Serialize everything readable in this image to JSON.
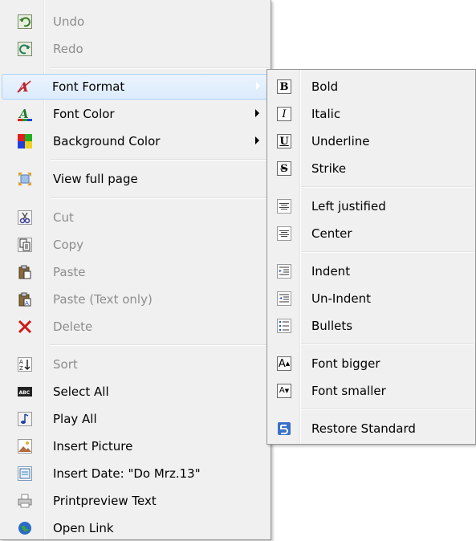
{
  "main_menu": {
    "items": [
      {
        "label": "Undo",
        "icon": "undo-icon",
        "disabled": true
      },
      {
        "label": "Redo",
        "icon": "redo-icon",
        "disabled": true
      },
      {
        "label": "Font Format",
        "icon": "font-format-icon",
        "disabled": false,
        "submenu": true,
        "highlighted": true
      },
      {
        "label": "Font Color",
        "icon": "font-color-icon",
        "disabled": false,
        "submenu": true
      },
      {
        "label": "Background Color",
        "icon": "background-color-icon",
        "disabled": false,
        "submenu": true
      },
      {
        "label": "View full page",
        "icon": "view-full-page-icon",
        "disabled": false
      },
      {
        "label": "Cut",
        "icon": "scissors-icon",
        "disabled": true
      },
      {
        "label": "Copy",
        "icon": "copy-icon",
        "disabled": true
      },
      {
        "label": "Paste",
        "icon": "paste-icon",
        "disabled": true
      },
      {
        "label": "Paste (Text only)",
        "icon": "paste-text-icon",
        "disabled": true
      },
      {
        "label": "Delete",
        "icon": "delete-icon",
        "disabled": true
      },
      {
        "label": "Sort",
        "icon": "sort-icon",
        "disabled": true
      },
      {
        "label": "Select All",
        "icon": "select-all-icon",
        "disabled": false
      },
      {
        "label": "Play All",
        "icon": "play-all-icon",
        "disabled": false
      },
      {
        "label": "Insert Picture",
        "icon": "insert-picture-icon",
        "disabled": false
      },
      {
        "label": "Insert Date: \"Do Mrz.13\"",
        "icon": "insert-date-icon",
        "disabled": false
      },
      {
        "label": "Printpreview Text",
        "icon": "print-preview-icon",
        "disabled": false
      },
      {
        "label": "Open Link",
        "icon": "globe-icon",
        "disabled": false
      }
    ]
  },
  "sub_menu": {
    "items": [
      {
        "label": "Bold",
        "icon": "bold-icon",
        "glyph": "B"
      },
      {
        "label": "Italic",
        "icon": "italic-icon",
        "glyph": "I"
      },
      {
        "label": "Underline",
        "icon": "underline-icon",
        "glyph": "U"
      },
      {
        "label": "Strike",
        "icon": "strike-icon",
        "glyph": "S"
      },
      {
        "label": "Left justified",
        "icon": "align-left-icon"
      },
      {
        "label": "Center",
        "icon": "align-center-icon"
      },
      {
        "label": "Indent",
        "icon": "indent-icon"
      },
      {
        "label": "Un-Indent",
        "icon": "unindent-icon"
      },
      {
        "label": "Bullets",
        "icon": "bullets-icon"
      },
      {
        "label": "Font bigger",
        "icon": "font-bigger-icon",
        "glyph": "A"
      },
      {
        "label": "Font smaller",
        "icon": "font-smaller-icon",
        "glyph": "A"
      },
      {
        "label": "Restore Standard",
        "icon": "restore-standard-icon"
      }
    ]
  }
}
